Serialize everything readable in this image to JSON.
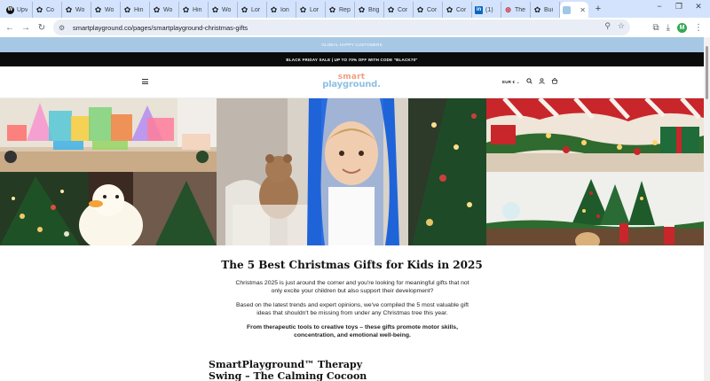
{
  "browser": {
    "tabs": [
      {
        "icon": "w",
        "title": "Upv"
      },
      {
        "icon": "gear",
        "title": "Co"
      },
      {
        "icon": "gear",
        "title": "Wo"
      },
      {
        "icon": "gear",
        "title": "Wo"
      },
      {
        "icon": "gear",
        "title": "Hin"
      },
      {
        "icon": "gear",
        "title": "Wo"
      },
      {
        "icon": "gear",
        "title": "Hin"
      },
      {
        "icon": "gear",
        "title": "Wo"
      },
      {
        "icon": "gear",
        "title": "Lor"
      },
      {
        "icon": "gear",
        "title": "Ion"
      },
      {
        "icon": "gear",
        "title": "Lor"
      },
      {
        "icon": "gear",
        "title": "Rep"
      },
      {
        "icon": "gear",
        "title": "Brig"
      },
      {
        "icon": "gear",
        "title": "Cor"
      },
      {
        "icon": "gear",
        "title": "Cor"
      },
      {
        "icon": "gear",
        "title": "Cor"
      },
      {
        "icon": "li",
        "title": "(1)"
      },
      {
        "icon": "pin",
        "title": "The"
      },
      {
        "icon": "gear",
        "title": "Bui"
      }
    ],
    "active_tab": {
      "icon": "sp",
      "close": "✕"
    },
    "new_tab": "+",
    "window_controls": {
      "minimize": "−",
      "restore": "❐",
      "close": "✕"
    },
    "url": "smartplayground.co/pages/smartplayground-christmas-gifts",
    "profile_initial": "M"
  },
  "site": {
    "banner1": "GLOBAL HAPPY CUSTOMERS",
    "banner2": "BLACK FRIDAY SALE | UP TO 70% OFF WITH CODE \"BLACK70\"",
    "logo": {
      "top": "smart",
      "bottom": "playground."
    },
    "currency": "EUR €",
    "currency_chevron": "⌄"
  },
  "article": {
    "title": "The 5 Best Christmas Gifts for Kids in 2025",
    "para1": "Christmas 2025 is just around the corner and you're looking for meaningful gifts that not only excite your children but also support their development?",
    "para2": "Based on the latest trends and expert opinions, we've compiled the 5 most valuable gift ideas that shouldn't be missing from under any Christmas tree this year.",
    "para3": "From therapeutic tools to creative toys – these gifts promote motor skills, concentration, and emotional well-being.",
    "h2_line1": "SmartPlayground™ Therapy",
    "h2_line2": "Swing – The Calming Cocoon"
  },
  "colors": {
    "banner_blue": "#a6c8e4",
    "logo_coral": "#f29d84",
    "logo_blue": "#8fc0e2",
    "swing_blue": "#1f63d8"
  }
}
